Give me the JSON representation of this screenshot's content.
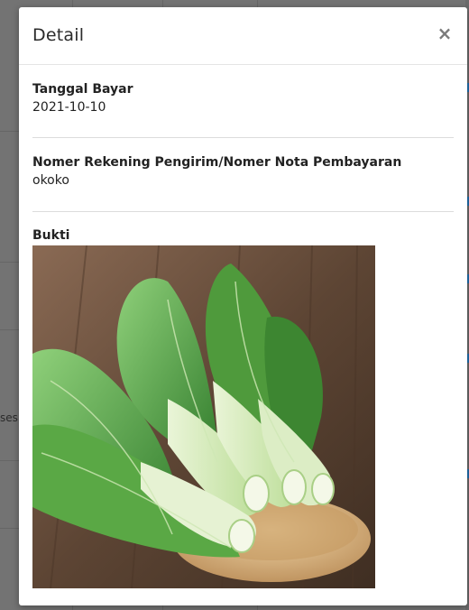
{
  "background": {
    "side_text": "ses"
  },
  "modal": {
    "title": "Detail",
    "close_label": "×",
    "fields": [
      {
        "label": "Tanggal Bayar",
        "value": "2021-10-10"
      },
      {
        "label": "Nomer Rekening Pengirim/Nomer Nota Pembayaran",
        "value": "okoko"
      }
    ],
    "proof": {
      "label": "Bukti",
      "image_subject": "bok choy in wooden bowl on wooden table"
    }
  }
}
